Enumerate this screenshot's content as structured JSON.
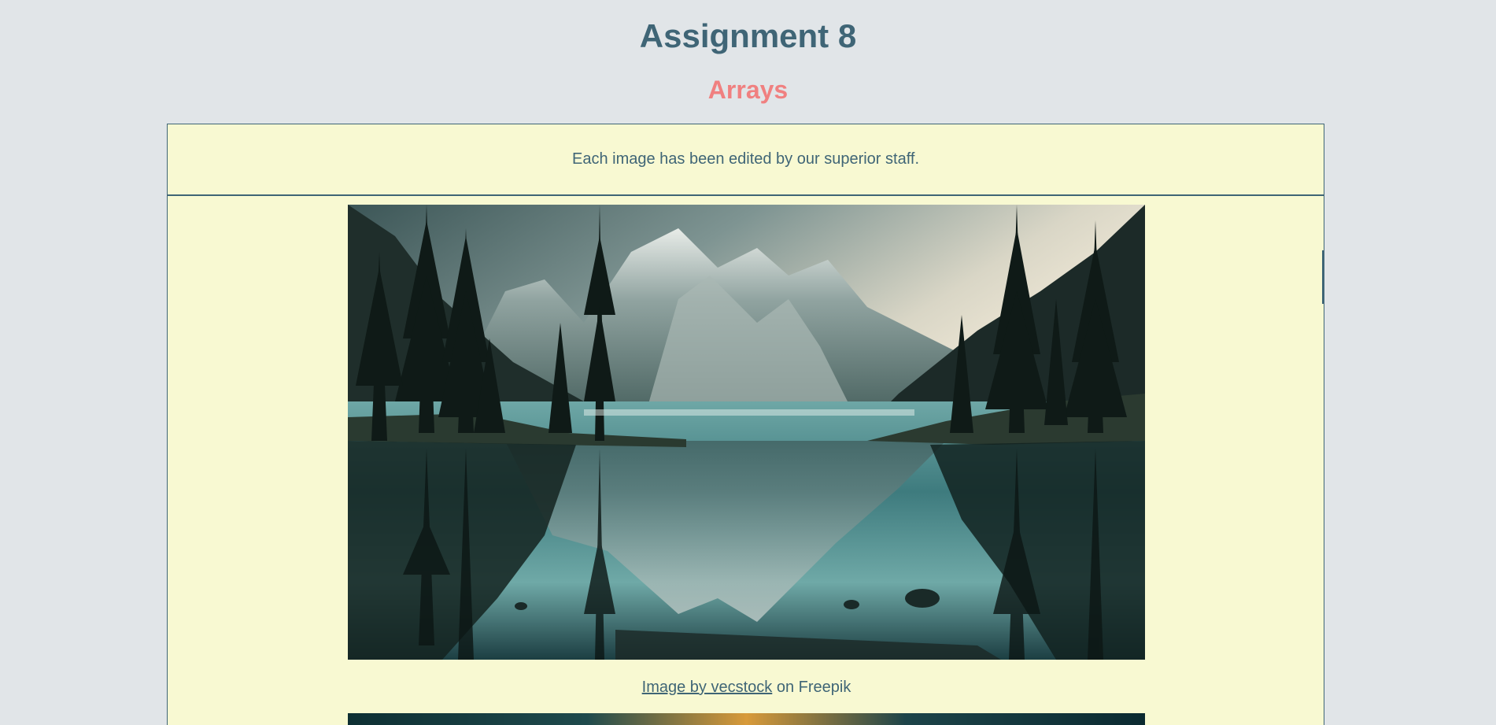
{
  "header": {
    "title": "Assignment 8",
    "subtitle": "Arrays"
  },
  "intro": {
    "text": "Each image has been edited by our superior staff."
  },
  "gallery": {
    "items": [
      {
        "image_subject": "mountain-lake-reflection",
        "credit_link": "Image by vecstock",
        "credit_suffix": " on Freepik"
      },
      {
        "image_subject": "dark-teal-landscape"
      }
    ]
  },
  "colors": {
    "page_bg": "#e1e5e8",
    "heading": "#3f6576",
    "accent": "#f08080",
    "panel_bg": "#f8f9d2"
  }
}
